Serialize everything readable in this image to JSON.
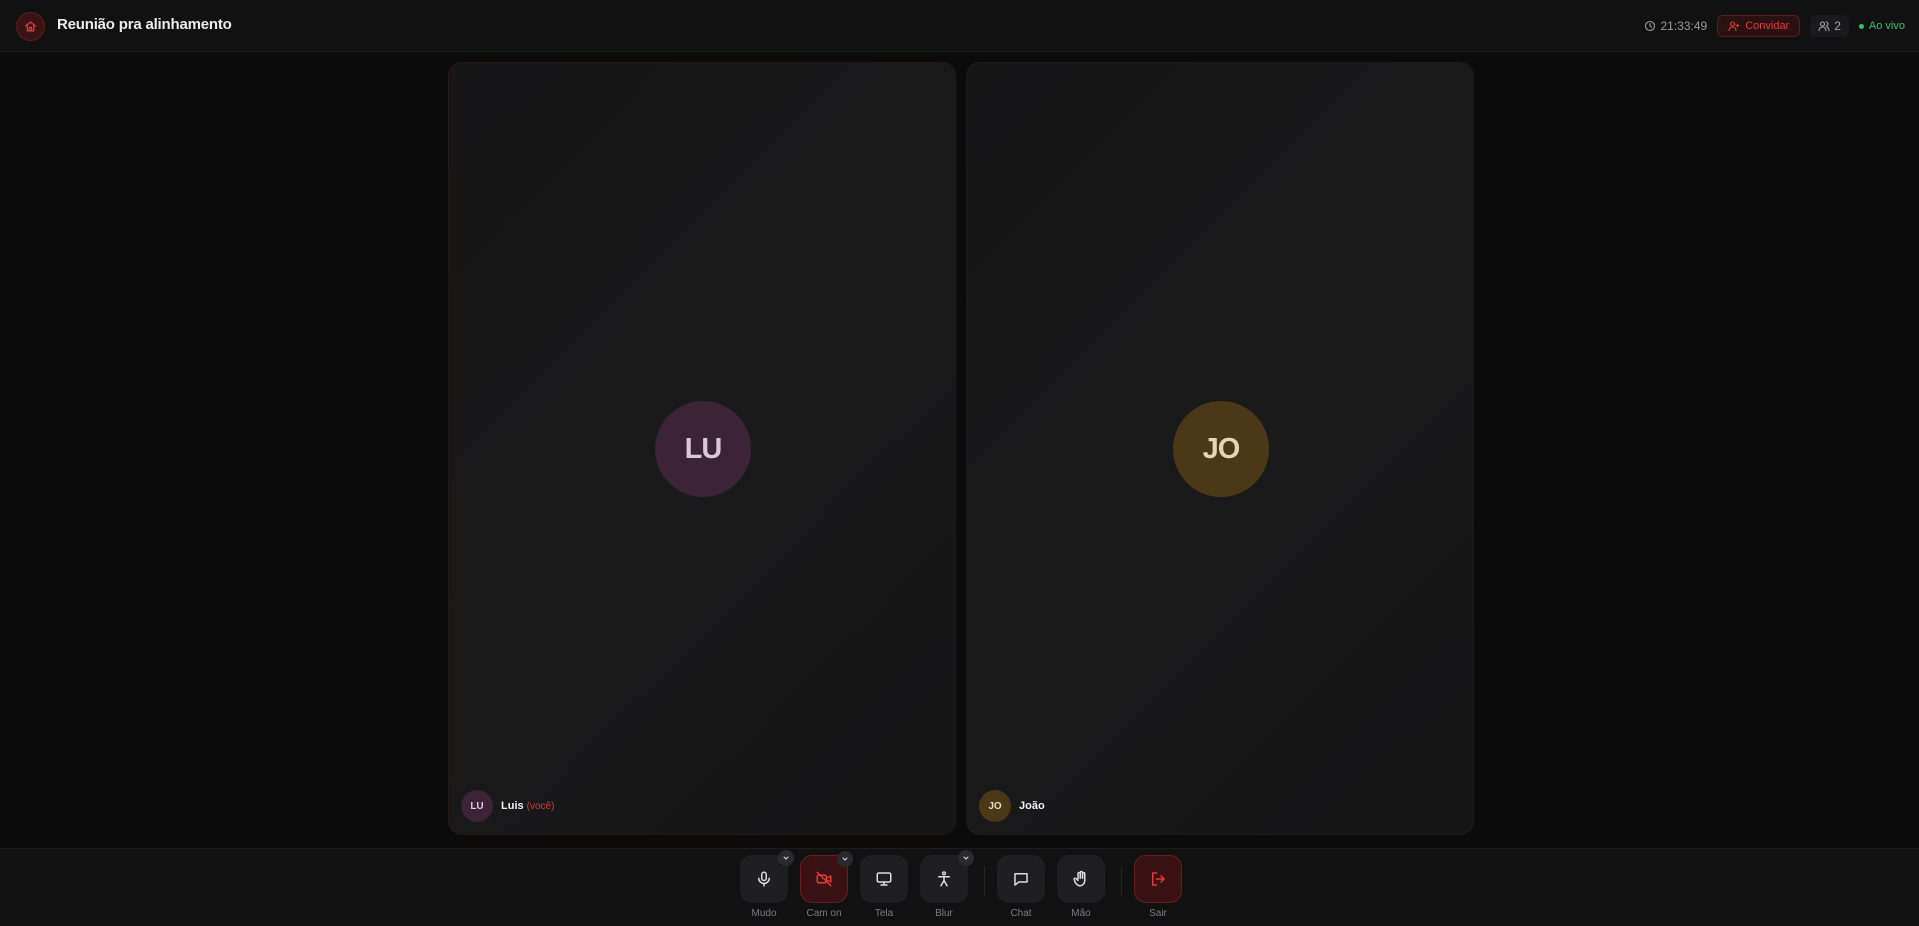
{
  "header": {
    "title": "Reunião pra alinhamento",
    "timer": "21:33:49",
    "invite_label": "Convidar",
    "participant_count": "2",
    "live_label": "Ao vivo"
  },
  "tiles": [
    {
      "initials": "LU",
      "name": "Luis",
      "you_label": "(você)",
      "color": "#3b2338"
    },
    {
      "initials": "JO",
      "name": "João",
      "color": "#4a3816"
    }
  ],
  "controls": {
    "mute": "Mudo",
    "camera": "Cam on",
    "screen": "Tela",
    "blur": "Blur",
    "chat": "Chat",
    "hand": "Mão",
    "leave": "Sair"
  },
  "colors": {
    "accent_red": "#e03a3a",
    "live_green": "#36c26a",
    "background": "#0b0b0c"
  }
}
